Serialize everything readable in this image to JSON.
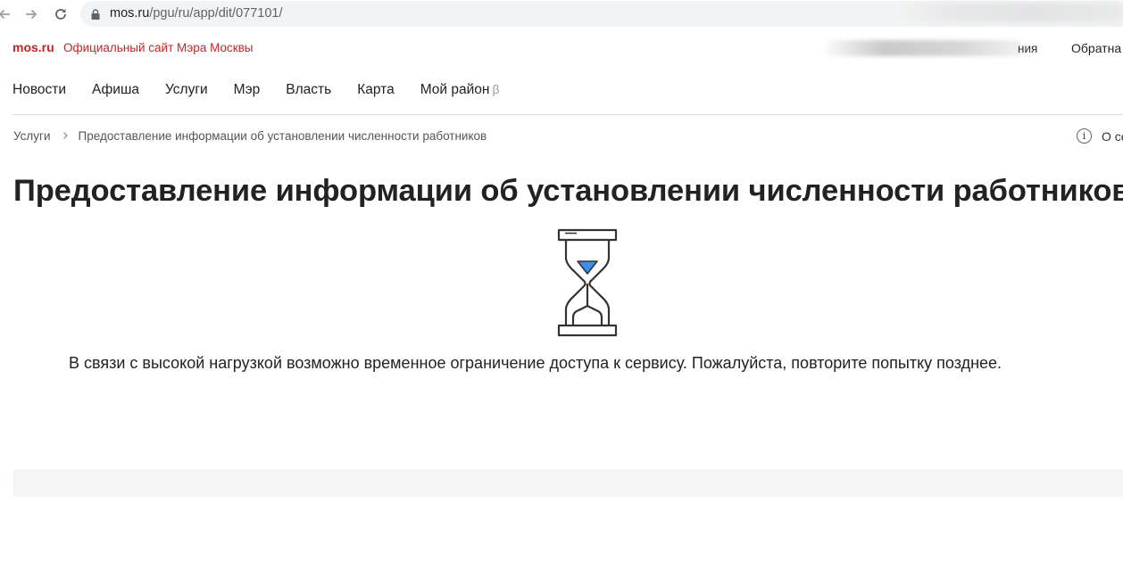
{
  "browser": {
    "back_icon": "arrow-left-icon",
    "forward_icon": "arrow-right-icon",
    "reload_icon": "reload-icon",
    "url_domain": "mos.ru",
    "url_path": "/pgu/ru/app/dit/077101/"
  },
  "header": {
    "logo": "mos.ru",
    "tagline": "Официальный сайт Мэра Москвы",
    "link_partial": "ния",
    "feedback_partial": "Обратна",
    "brand_color": "#cc2222"
  },
  "nav": {
    "items": [
      "Новости",
      "Афиша",
      "Услуги",
      "Мэр",
      "Власть",
      "Карта",
      "Мой район"
    ],
    "beta_mark": "β"
  },
  "breadcrumb": {
    "root": "Услуги",
    "current": "Предоставление информации об установлении численности работников",
    "info_icon_glyph": "i",
    "info_link_partial": "О се"
  },
  "page": {
    "title": "Предоставление информации об установлении численности работников",
    "notice": "В связи с высокой нагрузкой возможно временное ограничение доступа к сервису. Пожалуйста, повторите попытку позднее.",
    "status_icon": "hourglass-icon",
    "accent_color": "#3b8fe8"
  }
}
